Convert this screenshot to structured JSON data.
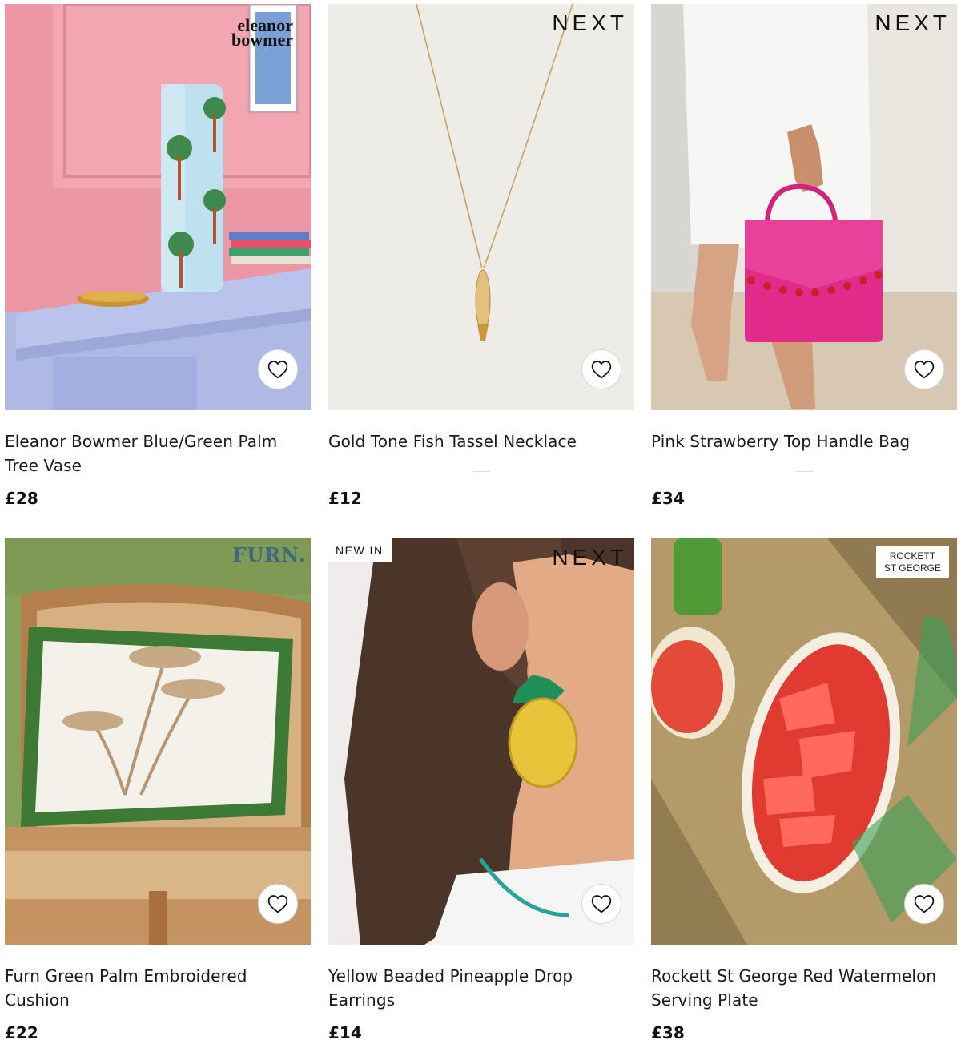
{
  "products": [
    {
      "title": "Eleanor Bowmer Blue/Green Palm Tree Vase",
      "price": "£28",
      "brand": "eleanor bowmer",
      "badge": "",
      "favorite_icon": "heart-outline-icon"
    },
    {
      "title": "Gold Tone Fish Tassel Necklace",
      "price": "£12",
      "brand": "NEXT",
      "badge": "",
      "favorite_icon": "heart-outline-icon"
    },
    {
      "title": "Pink Strawberry Top Handle Bag",
      "price": "£34",
      "brand": "NEXT",
      "badge": "",
      "favorite_icon": "heart-outline-icon"
    },
    {
      "title": "Furn Green Palm Embroidered Cushion",
      "price": "£22",
      "brand": "FURN.",
      "badge": "",
      "favorite_icon": "heart-outline-icon"
    },
    {
      "title": "Yellow Beaded Pineapple Drop Earrings",
      "price": "£14",
      "brand": "NEXT",
      "badge": "NEW IN",
      "favorite_icon": "heart-outline-icon"
    },
    {
      "title": "Rockett St George Red Watermelon Serving Plate",
      "price": "£38",
      "brand_line1": "ROCKETT",
      "brand_line2": "ST GEORGE",
      "badge": "",
      "favorite_icon": "heart-outline-icon"
    }
  ],
  "colors": {
    "text": "#1a1a1a",
    "favorite_border": "#d6d6d6",
    "background": "#ffffff"
  }
}
